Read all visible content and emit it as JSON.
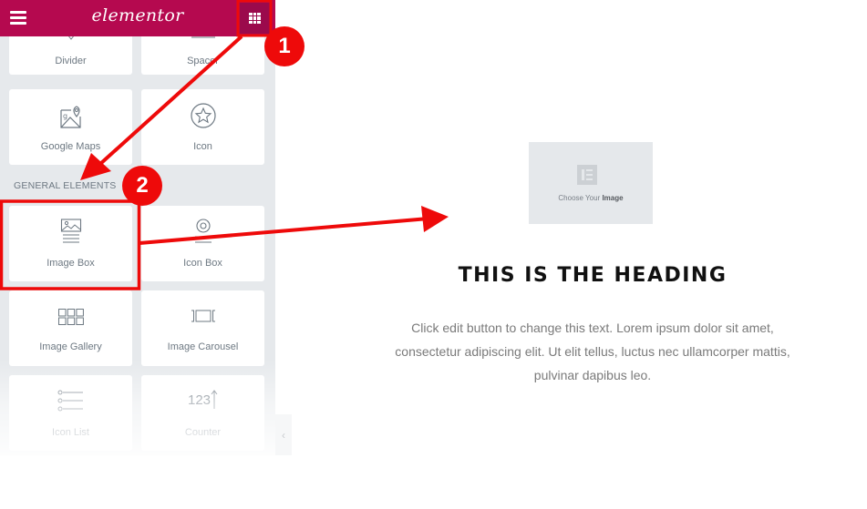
{
  "panel": {
    "header": {
      "logo": "elementor",
      "menu_icon": "hamburger-icon",
      "widgets_icon": "grid-icon"
    },
    "top_widgets": [
      {
        "label": "Divider",
        "icon": "divider-icon"
      },
      {
        "label": "Spacer",
        "icon": "spacer-icon"
      },
      {
        "label": "Google Maps",
        "icon": "google-maps-icon"
      },
      {
        "label": "Icon",
        "icon": "star-icon"
      }
    ],
    "section_title": "GENERAL ELEMENTS",
    "general_widgets": [
      {
        "label": "Image Box",
        "icon": "image-box-icon"
      },
      {
        "label": "Icon Box",
        "icon": "icon-box-icon"
      },
      {
        "label": "Image Gallery",
        "icon": "image-gallery-icon"
      },
      {
        "label": "Image Carousel",
        "icon": "image-carousel-icon"
      },
      {
        "label": "Icon List",
        "icon": "icon-list-icon"
      },
      {
        "label": "Counter",
        "icon": "counter-icon"
      }
    ],
    "counter_glyph": "123",
    "collapse_icon": "‹"
  },
  "canvas": {
    "image_placeholder": {
      "text_prefix": "Choose Your ",
      "text_bold": "Image"
    },
    "heading": "THIS IS THE HEADING",
    "body": "Click edit button to change this text. Lorem ipsum dolor sit amet, consectetur adipiscing elit. Ut elit tellus, luctus nec ullamcorper mattis, pulvinar dapibus leo."
  },
  "annotations": {
    "step1": "1",
    "step2": "2",
    "color": "#ee0a0a"
  }
}
